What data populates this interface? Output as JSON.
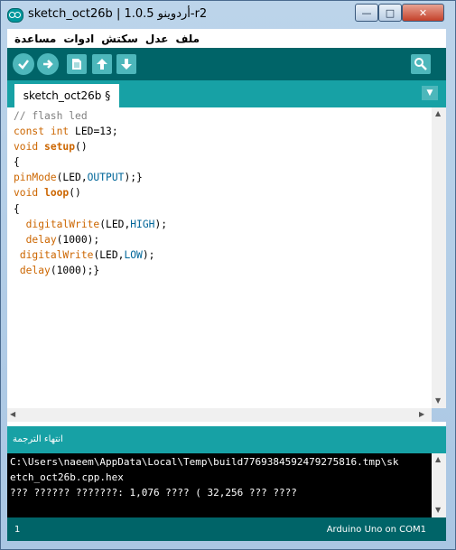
{
  "window": {
    "title": "sketch_oct26b | 1.0.5 أردوينو-r2",
    "controls": {
      "minimize": "—",
      "maximize": "□",
      "close": "✕"
    }
  },
  "menu": [
    "ملف",
    "عدل",
    "سكتش",
    "ادوات",
    "مساعدة"
  ],
  "toolbar": {
    "buttons": [
      "verify-icon",
      "upload-icon",
      "new-icon",
      "open-icon",
      "save-icon"
    ],
    "serial_monitor": "serial-monitor-icon"
  },
  "tab": {
    "label": "sketch_oct26b §"
  },
  "code_lines": [
    "// flash led",
    "const int LED=13;",
    "void setup()",
    "{",
    "pinMode(LED,OUTPUT);}",
    "void loop()",
    "{",
    "  digitalWrite(LED,HIGH);",
    "  delay(1000);",
    " digitalWrite(LED,LOW);",
    " delay(1000);}"
  ],
  "status": {
    "message": "انتهاء الترجمة"
  },
  "console": {
    "lines": [
      "C:\\Users\\naeem\\AppData\\Local\\Temp\\build7769384592479275816.tmp\\sk",
      "etch_oct26b.cpp.hex",
      "??? ?????? ???????: 1,076 ???? ( 32,256 ??? ????"
    ]
  },
  "footer": {
    "line_number": "1",
    "board": "Arduino Uno on COM1"
  },
  "colors": {
    "toolbar": "#006468",
    "tabbar": "#17a1a5",
    "keyword": "#cc6600",
    "constant": "#006699",
    "comment": "#808080"
  }
}
